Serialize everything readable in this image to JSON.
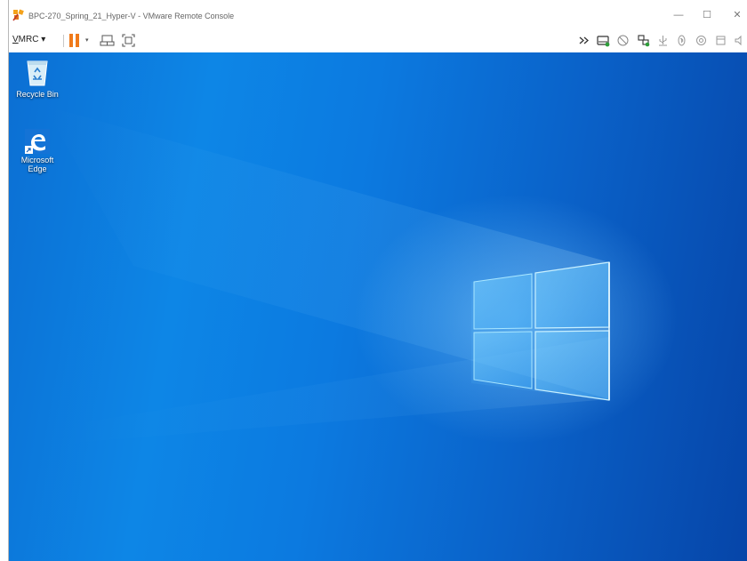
{
  "window": {
    "title": "BPC-270_Spring_21_Hyper-V - VMware Remote Console",
    "minimize_glyph": "—",
    "maximize_glyph": "☐",
    "close_glyph": "✕"
  },
  "toolbar": {
    "vmrc_menu_label": "VMRC",
    "vmrc_accel": "V",
    "vmrc_rest": "MRC",
    "dropdown_glyph": "▾",
    "right_icons": [
      "chevrons-right-icon",
      "removable-drive-icon",
      "cd-dvd-icon",
      "network-adapter-icon",
      "usb-icon",
      "bluetooth-icon",
      "sound-card-icon",
      "printer-icon",
      "speaker-icon"
    ]
  },
  "desktop": {
    "icons": [
      {
        "name": "recycle-bin-icon",
        "label": "Recycle Bin"
      },
      {
        "name": "microsoft-edge-icon",
        "label_line1": "Microsoft",
        "label_line2": "Edge"
      }
    ],
    "colors": {
      "wallpaper_dark": "#0645a8",
      "wallpaper_light": "#0d86e6",
      "pause_orange": "#f07a1a"
    }
  }
}
